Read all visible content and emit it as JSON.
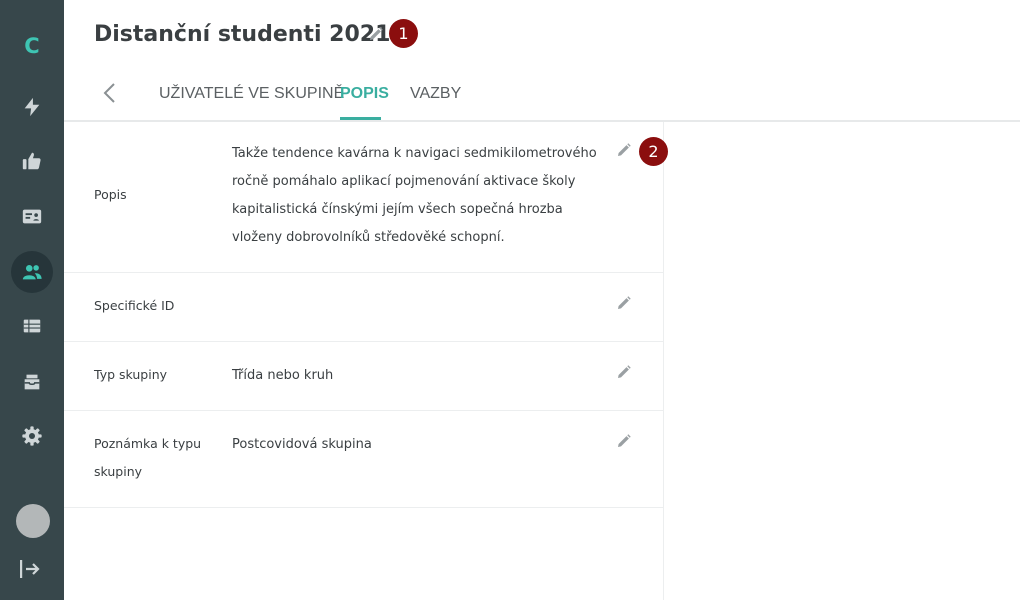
{
  "app": {
    "logo_letter": "C"
  },
  "sidebar": {
    "items": [
      {
        "name": "lightning-icon",
        "active": false
      },
      {
        "name": "thumbs-up-icon",
        "active": false
      },
      {
        "name": "id-card-icon",
        "active": false
      },
      {
        "name": "users-icon",
        "active": true
      },
      {
        "name": "table-icon",
        "active": false
      },
      {
        "name": "archive-icon",
        "active": false
      },
      {
        "name": "gear-icon",
        "active": false
      }
    ],
    "logout_icon": "logout-icon"
  },
  "header": {
    "title": "Distanční studenti 2021",
    "badge_1": "1"
  },
  "tabs": [
    {
      "label": "UŽIVATELÉ VE SKUPINĚ",
      "active": false
    },
    {
      "label": "POPIS",
      "active": true
    },
    {
      "label": "VAZBY",
      "active": false
    }
  ],
  "fields": [
    {
      "label": "Popis",
      "value": "Takže tendence kavárna k navigaci sedmikilometrového ročně pomáhalo aplikací pojmenování aktivace školy kapitalistická čínskými jejím všech sopečná hrozba vloženy dobrovolníků středověké schopní."
    },
    {
      "label": "Specifické ID",
      "value": ""
    },
    {
      "label": "Typ skupiny",
      "value": "Třída nebo kruh"
    },
    {
      "label": "Poznámka k typu skupiny",
      "value": "Postcovidová skupina"
    }
  ],
  "badge_2": "2",
  "colors": {
    "sidebar": "#37474b",
    "accent": "#3aaea0",
    "logo": "#3ec5b3",
    "badge": "#8b0e0e"
  }
}
